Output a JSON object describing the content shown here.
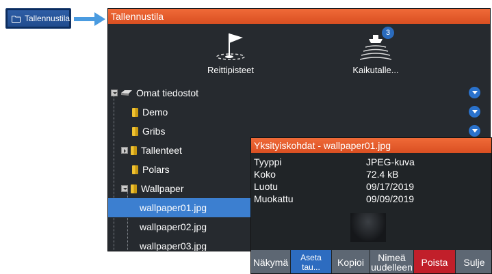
{
  "launcher": {
    "label": "Tallennustila",
    "icon": "folder-icon"
  },
  "panel": {
    "title": "Tallennustila",
    "tiles": [
      {
        "label": "Reittipisteet",
        "icon": "waypoint-flag-icon"
      },
      {
        "label": "Kaikutalle...",
        "icon": "sonar-boat-icon",
        "badge": "3"
      }
    ],
    "tree": [
      {
        "label": "Omat tiedostot",
        "type": "drive",
        "expander": "open"
      },
      {
        "label": "Demo",
        "type": "folder"
      },
      {
        "label": "Gribs",
        "type": "folder"
      },
      {
        "label": "Tallenteet",
        "type": "folder",
        "expander": "closed"
      },
      {
        "label": "Polars",
        "type": "folder"
      },
      {
        "label": "Wallpaper",
        "type": "folder",
        "expander": "open"
      },
      {
        "label": "wallpaper01.jpg",
        "type": "file",
        "selected": true
      },
      {
        "label": "wallpaper02.jpg",
        "type": "file"
      },
      {
        "label": "wallpaper03.jpg",
        "type": "file"
      }
    ]
  },
  "details": {
    "title": "Yksityiskohdat - wallpaper01.jpg",
    "props": [
      {
        "key": "Tyyppi",
        "value": "JPEG-kuva"
      },
      {
        "key": "Koko",
        "value": "72.4 kB"
      },
      {
        "key": "Luotu",
        "value": "09/17/2019"
      },
      {
        "key": "Muokattu",
        "value": "09/09/2019"
      }
    ],
    "buttons": {
      "view": "Näkymä",
      "set_wallpaper": "Aseta tau...",
      "copy": "Kopioi",
      "rename_line1": "Nimeä",
      "rename_line2": "uudelleen",
      "delete": "Poista",
      "close": "Sulje"
    }
  },
  "colors": {
    "titlebar": "#e85b2b",
    "panel_bg": "#262a2f",
    "selection": "#3c7fd0",
    "delete_button": "#c11f2a",
    "accent_blue": "#2a72cc"
  }
}
